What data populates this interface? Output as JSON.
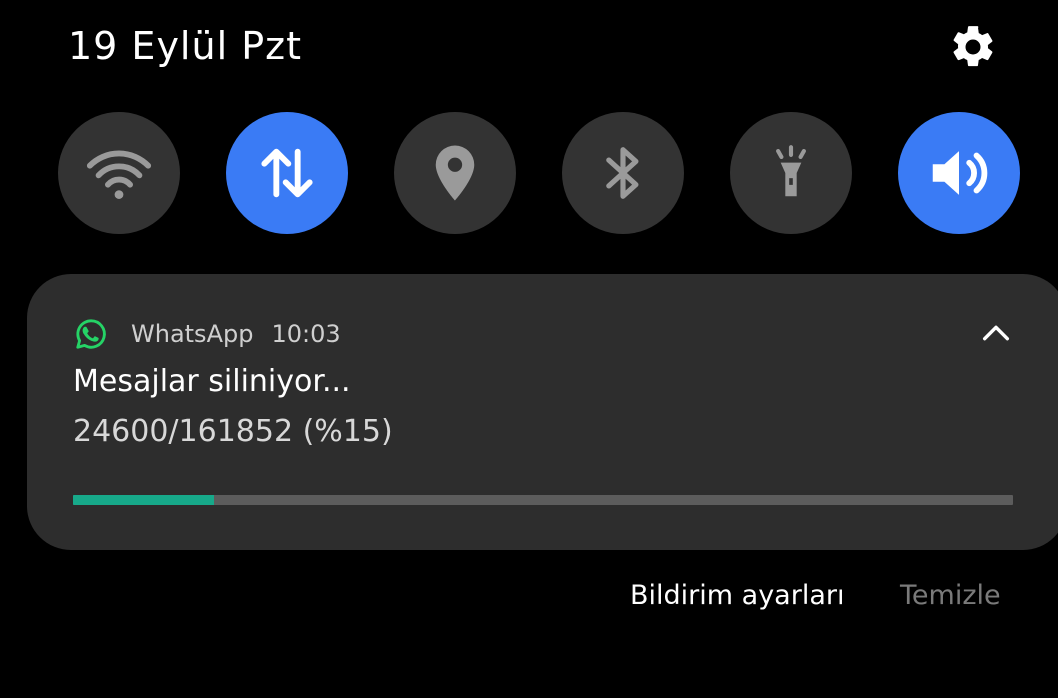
{
  "status": {
    "date_label": "19 Eylül Pzt",
    "settings_icon": "gear-icon"
  },
  "quick_settings": [
    {
      "id": "wifi",
      "icon": "wifi-icon",
      "active": false
    },
    {
      "id": "mobile-data",
      "icon": "data-transfer-icon",
      "active": true
    },
    {
      "id": "location",
      "icon": "location-pin-icon",
      "active": false
    },
    {
      "id": "bluetooth",
      "icon": "bluetooth-icon",
      "active": false
    },
    {
      "id": "flashlight",
      "icon": "flashlight-icon",
      "active": false
    },
    {
      "id": "sound",
      "icon": "speaker-icon",
      "active": true
    }
  ],
  "notification": {
    "app_name": "WhatsApp",
    "time": "10:03",
    "title": "Mesajlar siliniyor...",
    "body": "24600/161852 (%15)",
    "progress_fraction": 0.15,
    "app_icon": "whatsapp-icon",
    "collapse_icon": "chevron-up-icon"
  },
  "actions": {
    "settings_label": "Bildirim ayarları",
    "clear_label": "Temizle"
  },
  "colors": {
    "background": "#000000",
    "tile_inactive": "#333333",
    "tile_active": "#3a7bf5",
    "card": "#2d2d2d",
    "progress_fill": "#17a98a",
    "progress_track": "#5c5c5c",
    "whatsapp": "#25d366"
  }
}
